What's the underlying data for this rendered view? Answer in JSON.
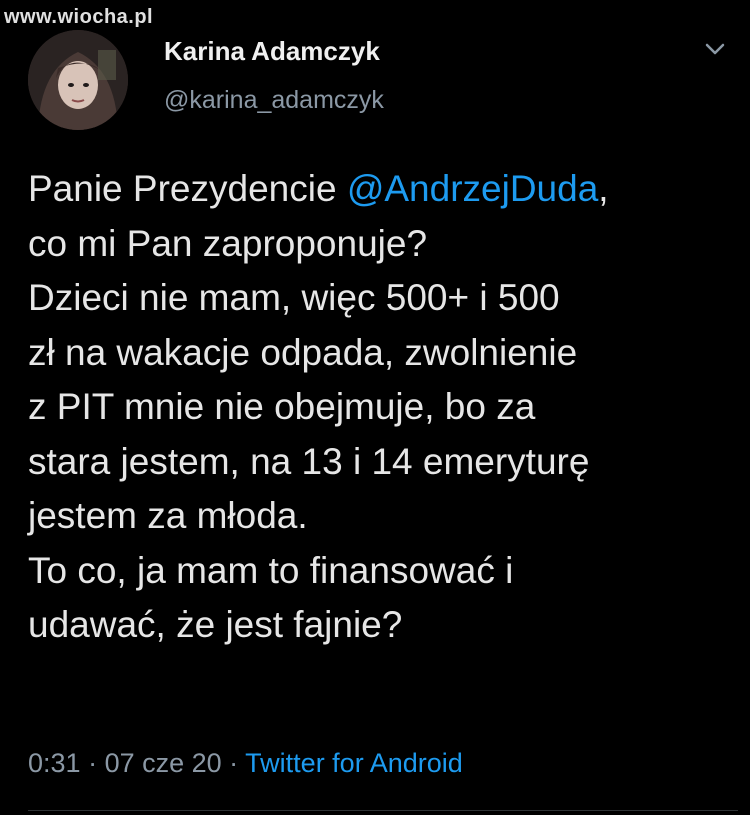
{
  "watermark": "www.wiocha.pl",
  "author": {
    "name": "Karina Adamczyk",
    "handle": "@karina_adamczyk"
  },
  "tweet": {
    "prefix": "Panie Prezydencie ",
    "mention": "@AndrzejDuda",
    "line1_end": ",",
    "line2": "co mi Pan zaproponuje?",
    "line3": "Dzieci nie mam, więc 500+ i 500",
    "line4": "zł na wakacje odpada, zwolnienie",
    "line5": "z PIT mnie nie obejmuje, bo za",
    "line6": "stara jestem, na 13 i 14 emeryturę",
    "line7": "jestem za młoda.",
    "line8": "To co, ja mam to finansować i",
    "line9": "udawać, że jest fajnie?"
  },
  "meta": {
    "time": "0:31",
    "sep1": " · ",
    "date": "07 cze 20",
    "sep2": " · ",
    "app": "Twitter for Android"
  },
  "icons": {
    "avatar": "profile-photo",
    "chevron": "chevron-down-icon"
  },
  "colors": {
    "background": "#000000",
    "text": "#e6e6e6",
    "secondary": "#8b98a5",
    "link": "#1d9bf0"
  }
}
